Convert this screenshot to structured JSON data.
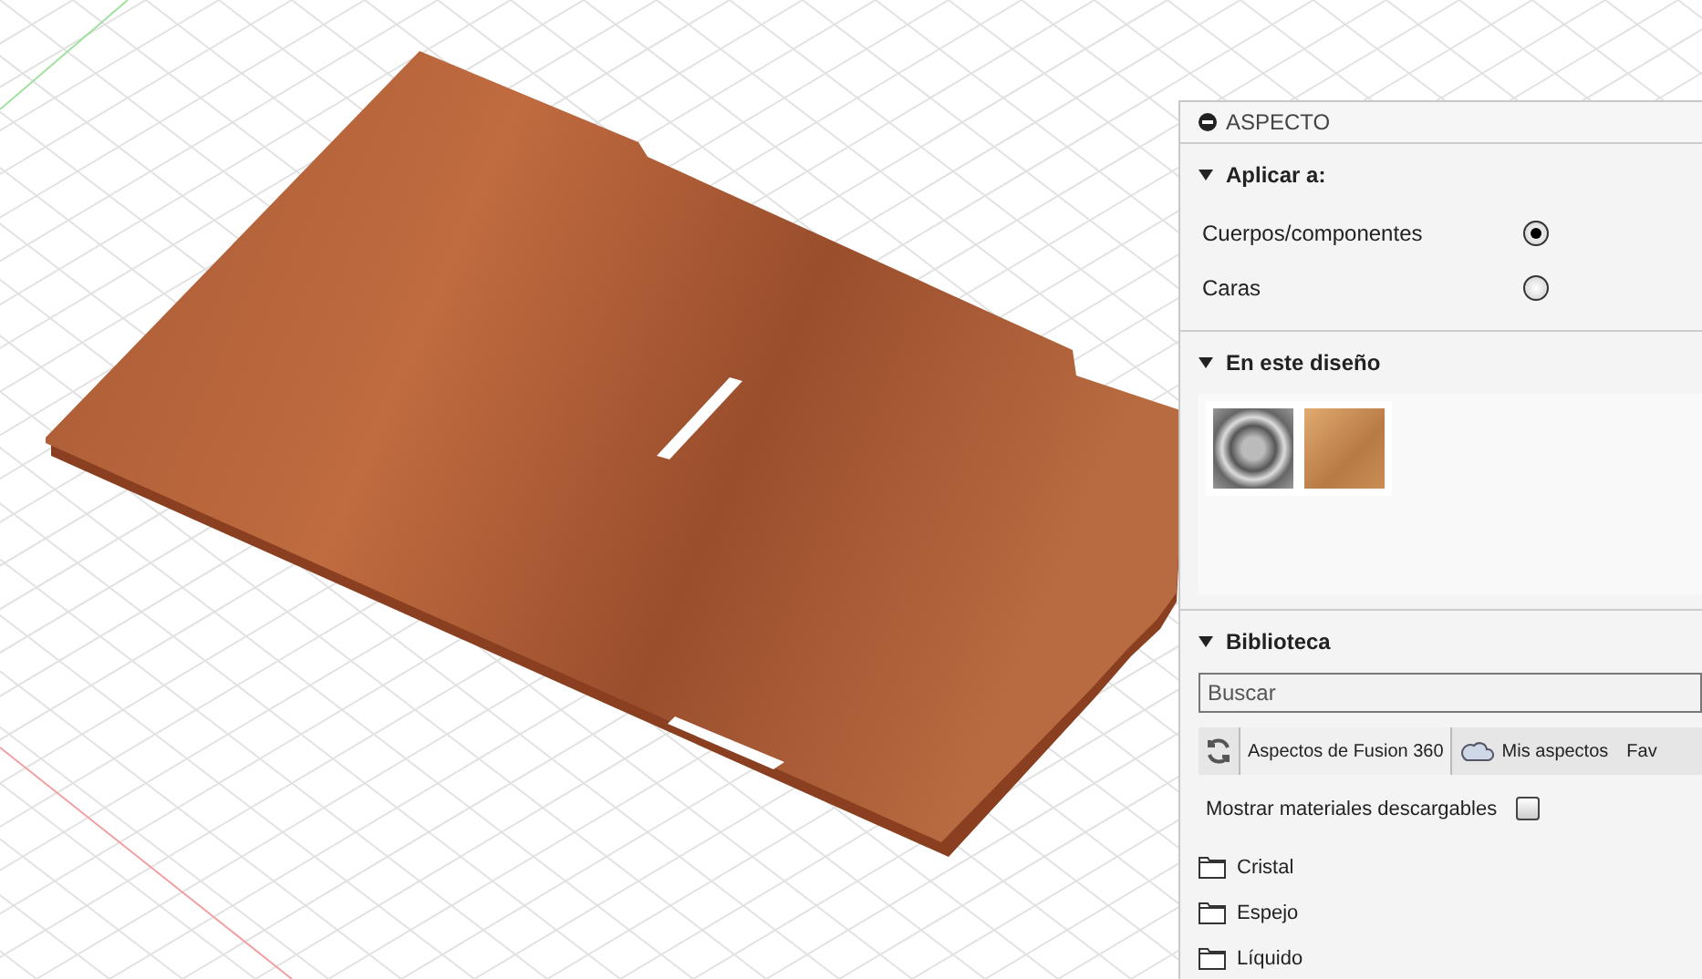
{
  "panel": {
    "title": "ASPECTO",
    "apply_section": {
      "title": "Aplicar a:",
      "expanded": true,
      "options": [
        {
          "label": "Cuerpos/componentes",
          "selected": true
        },
        {
          "label": "Caras",
          "selected": false
        }
      ]
    },
    "design_section": {
      "title": "En este diseño",
      "expanded": true,
      "swatches": [
        {
          "kind": "chrome"
        },
        {
          "kind": "wood"
        }
      ]
    },
    "library_section": {
      "title": "Biblioteca",
      "expanded": true,
      "search": {
        "placeholder": "Buscar"
      },
      "tabs": [
        {
          "label": "Aspectos de Fusion 360",
          "selected": true,
          "kind": "plain"
        },
        {
          "label": "Mis aspectos",
          "selected": false,
          "kind": "cloud"
        },
        {
          "label": "Fav",
          "selected": false,
          "kind": "plain"
        }
      ],
      "downloadable": {
        "label": "Mostrar materiales descargables",
        "checked": false
      },
      "folders": [
        {
          "label": "Cristal"
        },
        {
          "label": "Espejo"
        },
        {
          "label": "Líquido"
        }
      ]
    }
  }
}
